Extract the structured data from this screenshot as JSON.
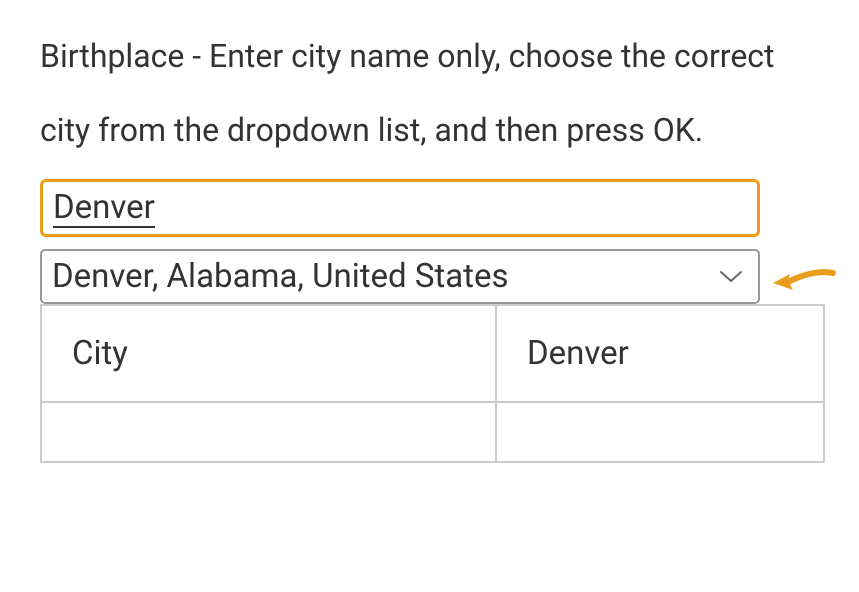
{
  "instruction": "Birthplace - Enter city name only, choose the correct city from the dropdown list, and then press OK.",
  "input": {
    "value": "Denver"
  },
  "dropdown": {
    "selected": "Denver, Alabama, United States"
  },
  "table": {
    "rows": [
      {
        "label": "City",
        "value": "Denver"
      }
    ]
  }
}
